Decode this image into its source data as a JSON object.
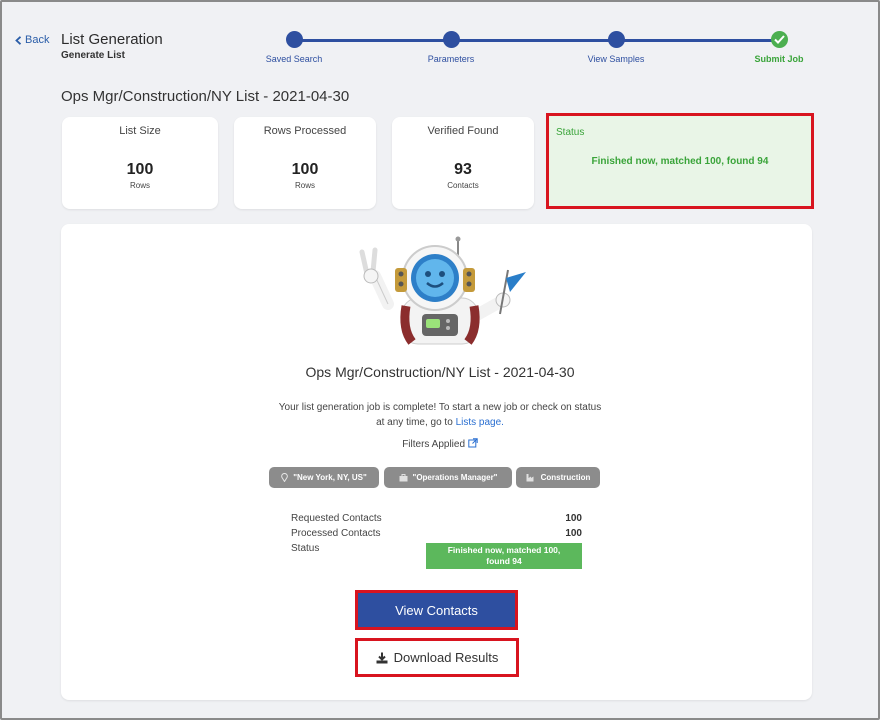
{
  "header": {
    "back_label": "Back",
    "title": "List Generation",
    "subtitle": "Generate List"
  },
  "stepper": {
    "steps": [
      {
        "label": "Saved Search"
      },
      {
        "label": "Parameters"
      },
      {
        "label": "View Samples"
      },
      {
        "label": "Submit Job"
      }
    ]
  },
  "list_name": "Ops Mgr/Construction/NY List - 2021-04-30",
  "stats": {
    "list_size": {
      "label": "List Size",
      "value": "100",
      "unit": "Rows"
    },
    "rows_processed": {
      "label": "Rows Processed",
      "value": "100",
      "unit": "Rows"
    },
    "verified_found": {
      "label": "Verified Found",
      "value": "93",
      "unit": "Contacts"
    },
    "status": {
      "label": "Status",
      "message": "Finished now, matched 100, found 94"
    }
  },
  "panel": {
    "title": "Ops Mgr/Construction/NY List - 2021-04-30",
    "message_line1": "Your list generation job is complete! To start a new job or check on status",
    "message_line2_prefix": "at any time, go to ",
    "message_link": "Lists page.",
    "filters_title": "Filters Applied",
    "filters": [
      {
        "icon": "location-pin-icon",
        "label": "\"New York, NY, US\""
      },
      {
        "icon": "briefcase-icon",
        "label": "\"Operations Manager\""
      },
      {
        "icon": "industry-icon",
        "label": "Construction"
      }
    ],
    "summary": {
      "requested_label": "Requested Contacts",
      "requested_value": "100",
      "processed_label": "Processed Contacts",
      "processed_value": "100",
      "status_label": "Status",
      "status_line1": "Finished now, matched 100,",
      "status_line2": "found 94"
    },
    "view_contacts_label": "View Contacts",
    "download_label": "Download Results"
  },
  "colors": {
    "primary": "#2e4fa0",
    "success": "#4caf50",
    "highlight": "#d8141f",
    "chip": "#8c8c8c"
  }
}
